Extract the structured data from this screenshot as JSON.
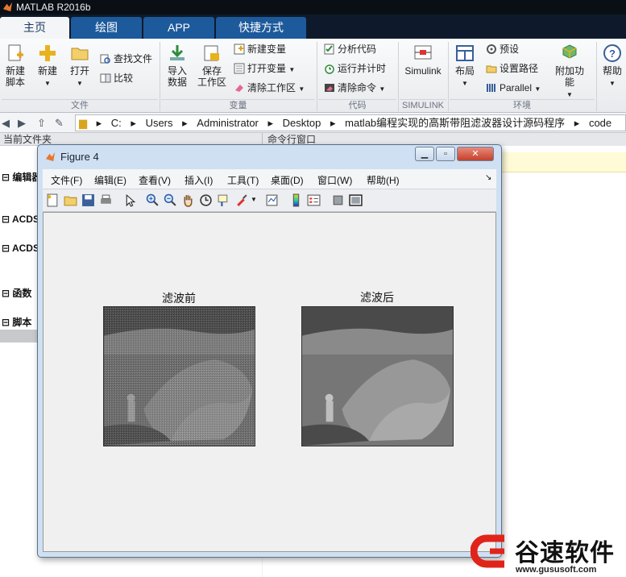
{
  "app": {
    "title": "MATLAB R2016b"
  },
  "tabs": [
    {
      "label": "主页",
      "active": true
    },
    {
      "label": "绘图",
      "active": false
    },
    {
      "label": "APP",
      "active": false
    },
    {
      "label": "快捷方式",
      "active": false
    }
  ],
  "ribbon": {
    "new_script": "新建\n脚本",
    "new": "新建",
    "open": "打开",
    "find_files": "查找文件",
    "compare": "比较",
    "import_data": "导入\n数据",
    "save_workspace": "保存\n工作区",
    "new_variable": "新建变量",
    "open_variable": "打开变量",
    "clear_workspace": "清除工作区",
    "analyze_code": "分析代码",
    "run_and_time": "运行并计时",
    "clear_commands": "清除命令",
    "simulink": "Simulink",
    "layout": "布局",
    "preferences": "预设",
    "set_path": "设置路径",
    "parallel": "Parallel",
    "addons": "附加功能",
    "help": "帮助",
    "groups": {
      "file": "文件",
      "variable": "变量",
      "code": "代码",
      "simulink": "SIMULINK",
      "environment": "环境"
    }
  },
  "address": {
    "crumbs": [
      "C:",
      "Users",
      "Administrator",
      "Desktop",
      "matlab编程实现的高斯带阻滤波器设计源码程序",
      "code"
    ]
  },
  "left_pane": {
    "header": "当前文件夹",
    "items": [
      "编辑器",
      "ACDS",
      "ACDS",
      "函数",
      "脚本"
    ]
  },
  "command_window": {
    "header": "命令行窗口"
  },
  "figure": {
    "title": "Figure 4",
    "menu": [
      "文件(F)",
      "编辑(E)",
      "查看(V)",
      "插入(I)",
      "工具(T)",
      "桌面(D)",
      "窗口(W)",
      "帮助(H)"
    ],
    "plots": [
      {
        "title": "滤波前"
      },
      {
        "title": "滤波后"
      }
    ]
  },
  "watermark": {
    "brand": "谷速软件",
    "url": "www.gususoft.com"
  },
  "colors": {
    "accent": "#1d5a9c",
    "title_bar": "#0a0f16"
  }
}
